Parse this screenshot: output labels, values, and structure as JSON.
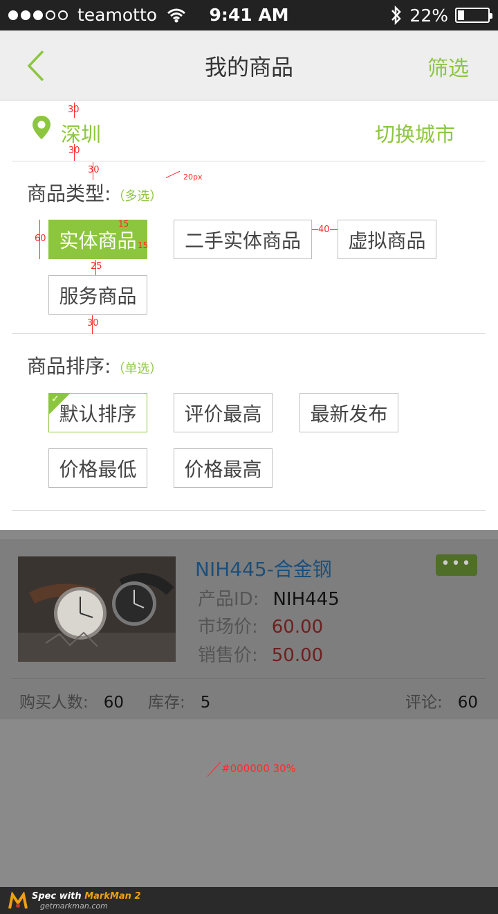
{
  "status_bar": {
    "carrier": "teamotto",
    "time": "9:41 AM",
    "battery_percent": "22%",
    "battery_level": 0.22,
    "signal_filled": 3,
    "signal_total": 5,
    "icons": [
      "wifi-icon",
      "bluetooth-icon",
      "battery-icon"
    ]
  },
  "nav": {
    "title": "我的商品",
    "filter_label": "筛选",
    "back_icon": "chevron-left-icon"
  },
  "location": {
    "city": "深圳",
    "switch_label": "切换城市",
    "icon": "location-pin-icon"
  },
  "product_type": {
    "title": "商品类型:",
    "hint": "（多选）",
    "options": [
      {
        "label": "实体商品",
        "selected": true
      },
      {
        "label": "二手实体商品",
        "selected": false
      },
      {
        "label": "虚拟商品",
        "selected": false
      },
      {
        "label": "服务商品",
        "selected": false
      }
    ]
  },
  "sort": {
    "title": "商品排序:",
    "hint": "（单选）",
    "options": [
      {
        "label": "默认排序",
        "selected": true
      },
      {
        "label": "评价最高",
        "selected": false
      },
      {
        "label": "最新发布",
        "selected": false
      },
      {
        "label": "价格最低",
        "selected": false
      },
      {
        "label": "价格最高",
        "selected": false
      }
    ]
  },
  "product_card": {
    "name": "NIH445-合金钢",
    "id_label": "产品ID:",
    "id_value": "NIH445",
    "market_price_label": "市场价:",
    "market_price": "60.00",
    "sale_price_label": "销售价:",
    "sale_price": "50.00",
    "buyers_label": "购买人数:",
    "buyers": "60",
    "stock_label": "库存:",
    "stock": "5",
    "comments_label": "评论:",
    "comments": "60",
    "more_icon": "more-dots-icon"
  },
  "annotations": {
    "overlay_note": "#000000 30%",
    "spacing": [
      "30",
      "30",
      "30",
      "20px",
      "15",
      "15",
      "60",
      "40",
      "25",
      "30"
    ]
  },
  "markman": {
    "title_prefix": "Spec with ",
    "brand": "MarkMan 2",
    "url": "getmarkman.com"
  },
  "colors": {
    "accent": "#8cc63f",
    "annotation": "#ff2a2a",
    "overlay": "#000000"
  }
}
